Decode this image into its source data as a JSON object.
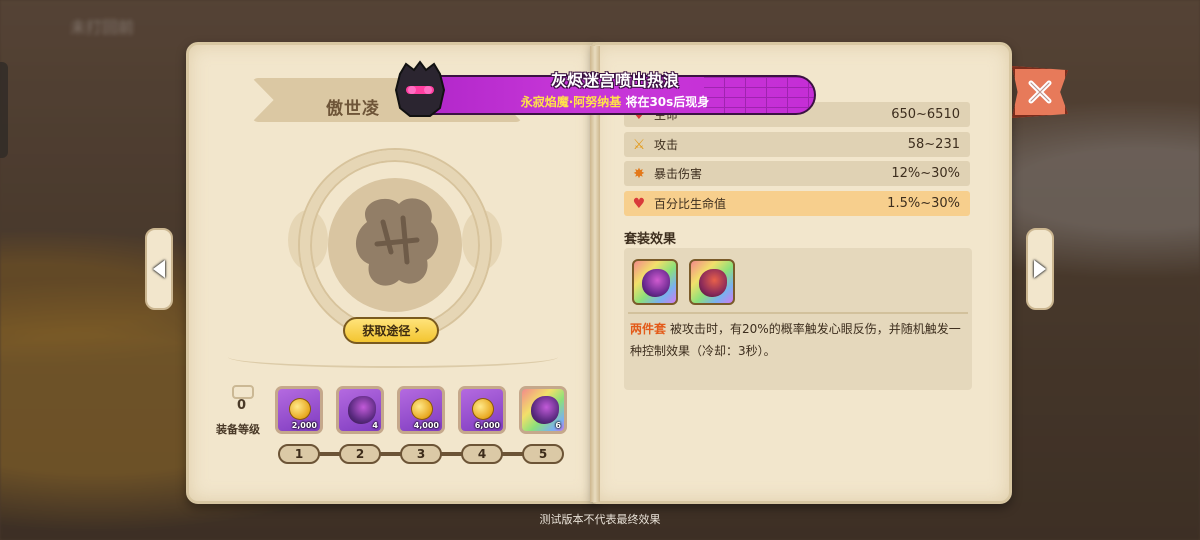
{
  "background": {
    "blurred_title": "未打回前"
  },
  "left_page": {
    "set_name": "傲世凌",
    "source_button": "获取途径",
    "equip_level_value": "0",
    "equip_level_label": "装备等级",
    "slots": [
      {
        "icon": "gold-coin-icon",
        "qty": "2,000",
        "style": "purple"
      },
      {
        "icon": "dragon-gear-icon",
        "qty": "4",
        "style": "purple"
      },
      {
        "icon": "gold-coin-icon",
        "qty": "4,000",
        "style": "purple"
      },
      {
        "icon": "gold-coin-icon",
        "qty": "6,000",
        "style": "purple"
      },
      {
        "icon": "dragon-gear-icon",
        "qty": "6",
        "style": "rainbow"
      }
    ],
    "slot_numbers": [
      "1",
      "2",
      "3",
      "4",
      "5"
    ]
  },
  "right_page": {
    "stats": [
      {
        "icon": "heart-icon",
        "label": "生命",
        "value": "650~6510"
      },
      {
        "icon": "sword-icon",
        "label": "攻击",
        "value": "58~231"
      },
      {
        "icon": "crit-burst-icon",
        "label": "暴击伤害",
        "value": "12%~30%"
      },
      {
        "icon": "heart-icon",
        "label": "百分比生命值",
        "value": "1.5%~30%",
        "highlight": true
      }
    ],
    "set_effect_heading": "套装效果",
    "set_items": [
      "purple-dragon-armor-icon",
      "red-dragon-armor-icon"
    ],
    "set_bonus_tag": "两件套",
    "set_bonus_text": "被攻击时，有20%的概率触发心眼反伤，并随机触发一种控制效果（冷却：3秒）。"
  },
  "notice": {
    "title": "灰烬迷宫喷出热浪",
    "boss_name": "永寂焰魔·阿努纳基",
    "suffix": " 将在30s后现身"
  },
  "footer": "测试版本不代表最终效果",
  "colors": {
    "page": "#f2e6cc",
    "notice_purple": "#c737d8",
    "highlight_row": "#f7cf8d",
    "bonus_tag": "#e35b1a",
    "close": "#e77a5a"
  }
}
